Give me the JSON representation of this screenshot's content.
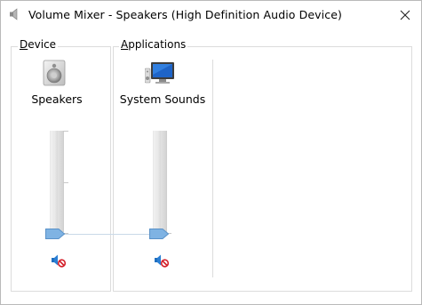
{
  "window": {
    "title": "Volume Mixer - Speakers (High Definition Audio Device)",
    "title_icon": "speaker-icon",
    "close_icon": "close-icon"
  },
  "device": {
    "group_label_accel": "D",
    "group_label_rest": "evice",
    "name": "Speakers",
    "icon": "speakers-device-icon",
    "volume_level": 0,
    "muted": true,
    "mute_icon": "muted-speaker-icon"
  },
  "applications": {
    "group_label_accel": "A",
    "group_label_rest": "pplications",
    "items": [
      {
        "name": "System Sounds",
        "icon": "system-sounds-icon",
        "volume_level": 0,
        "muted": true,
        "mute_icon": "muted-speaker-icon"
      }
    ]
  },
  "colors": {
    "thumb": "#6ea7dc",
    "mute_cross": "#d4202a",
    "speaker_blue": "#1f6fc0",
    "group_border": "#dcdcdc"
  }
}
